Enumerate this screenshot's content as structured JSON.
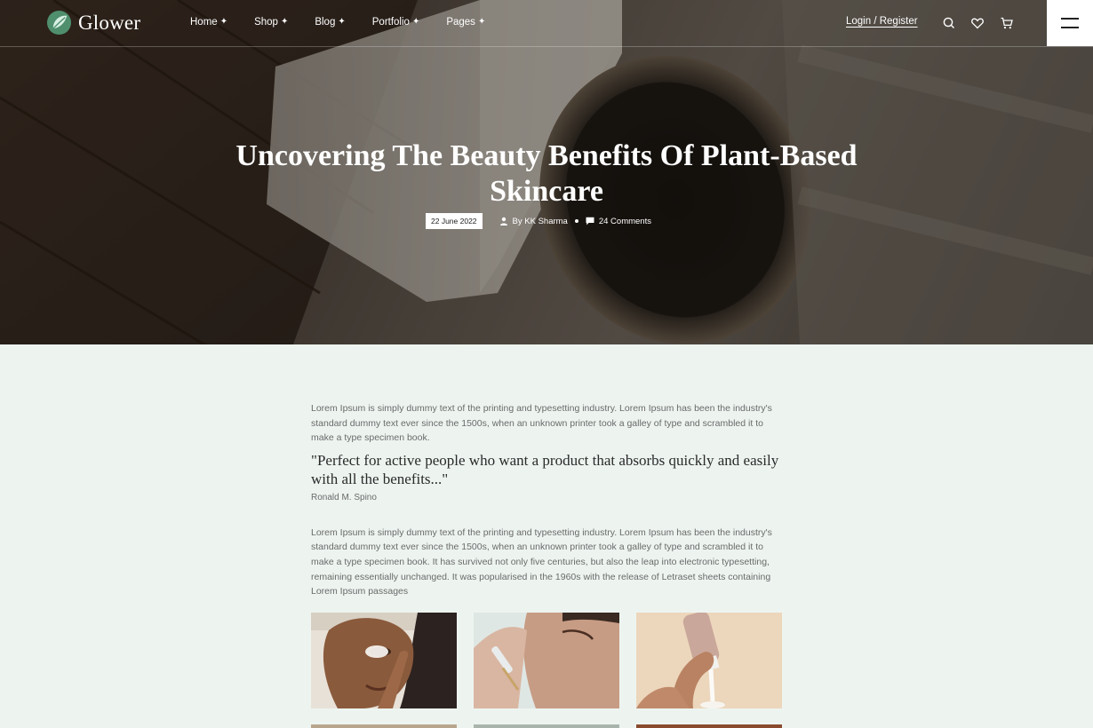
{
  "header": {
    "logo_text": "Glower",
    "nav": [
      {
        "label": "Home"
      },
      {
        "label": "Shop"
      },
      {
        "label": "Blog"
      },
      {
        "label": "Portfolio"
      },
      {
        "label": "Pages"
      }
    ],
    "nav_suffix": "✦",
    "login_label": "Login / Register",
    "icons": [
      "search-icon",
      "heart-icon",
      "cart-icon",
      "menu-icon"
    ]
  },
  "hero": {
    "title": "Uncovering The Beauty Benefits Of Plant-Based Skincare",
    "date": "22 June 2022",
    "author": "By KK Sharma",
    "comments": "24 Comments"
  },
  "article": {
    "intro": "Lorem Ipsum is simply dummy text of the printing and typesetting industry. Lorem Ipsum has been the industry's standard dummy text ever since the 1500s, when an unknown printer took a galley of type and scrambled it to make a type specimen book.",
    "quote": "\"Perfect for active people who want a product that absorbs quickly and easily with all the benefits...\"",
    "quote_author": "Ronald M. Spino",
    "body": "Lorem Ipsum is simply dummy text of the printing and typesetting industry. Lorem Ipsum has been the industry's standard dummy text ever since the 1500s, when an unknown printer took a galley of type and scrambled it to make a type specimen book. It has survived not only five centuries, but also the leap into electronic typesetting, remaining essentially unchanged. It was popularised in the 1960s with the release of Letraset sheets containing Lorem Ipsum passages"
  },
  "colors": {
    "page_bg": "#edf4f0",
    "logo_green": "#4f8f6e",
    "text_body": "#6a6a6a",
    "text_dark": "#2a2a2a"
  }
}
